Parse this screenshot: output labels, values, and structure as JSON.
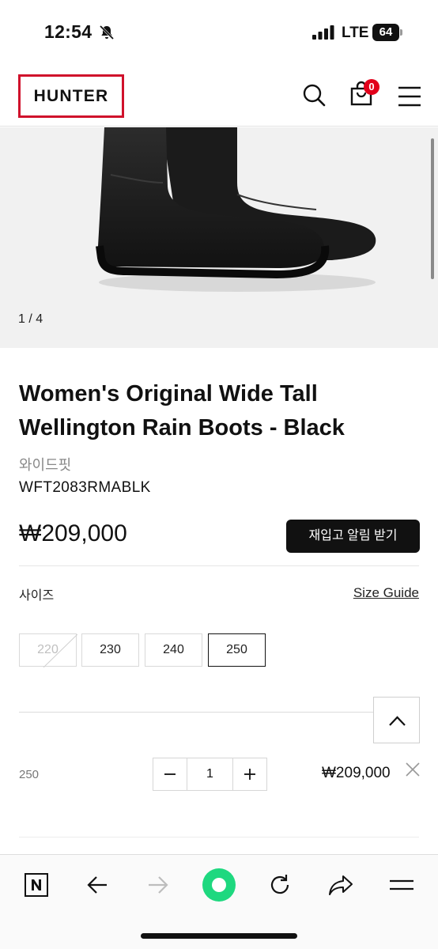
{
  "status_bar": {
    "time": "12:54",
    "network": "LTE",
    "battery": "64"
  },
  "header": {
    "logo_text": "HUNTER",
    "cart_count": "0"
  },
  "gallery": {
    "counter": "1 / 4"
  },
  "product": {
    "title": "Women's Original Wide Tall Wellington Rain Boots - Black",
    "fit": "와이드핏",
    "sku": "WFT2083RMABLK",
    "price": "₩209,000",
    "restock_label": "재입고 알림 받기"
  },
  "size_section": {
    "label": "사이즈",
    "guide_label": "Size Guide",
    "options": [
      {
        "value": "220",
        "available": false
      },
      {
        "value": "230",
        "available": true
      },
      {
        "value": "240",
        "available": true
      },
      {
        "value": "250",
        "available": true,
        "selected": true
      }
    ]
  },
  "selection": {
    "size": "250",
    "quantity": "1",
    "line_price": "₩209,000"
  },
  "colors": {
    "brand_red": "#d0112b",
    "badge_red": "#e2001a",
    "accent_green": "#1ed87f"
  }
}
